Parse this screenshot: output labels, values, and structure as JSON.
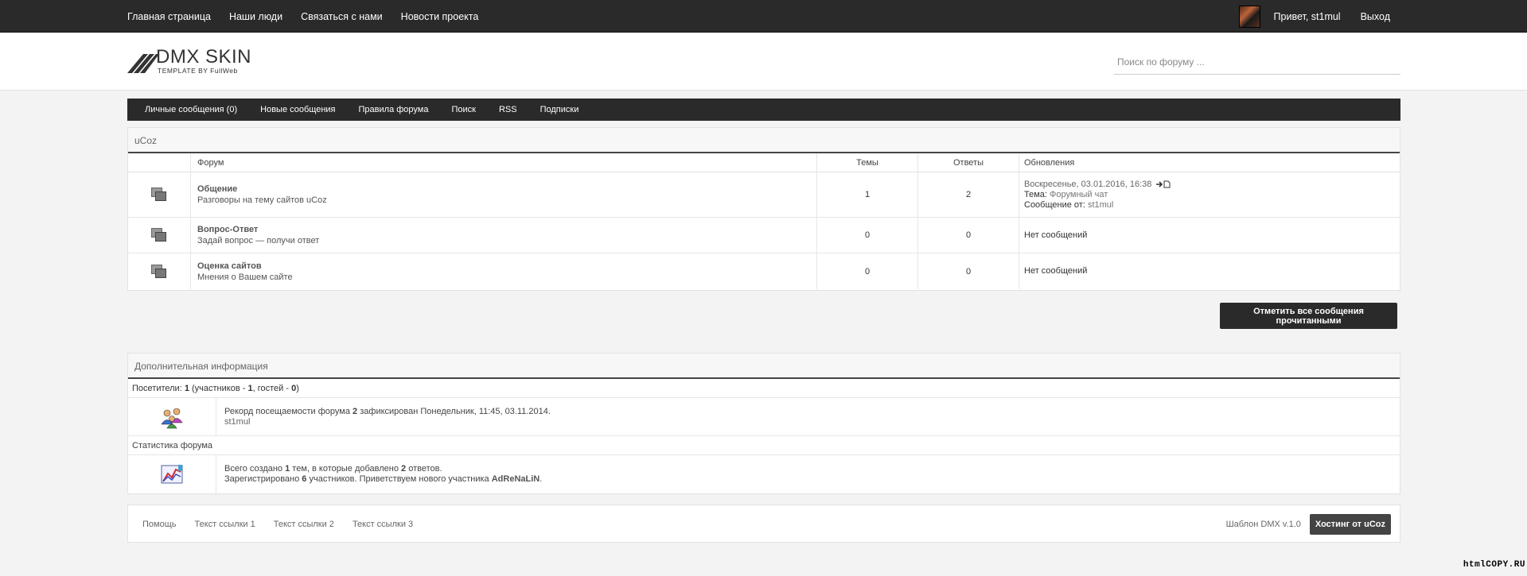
{
  "topbar": {
    "nav": [
      "Главная страница",
      "Наши люди",
      "Связаться с нами",
      "Новости проекта"
    ],
    "greeting": "Привет, st1mul",
    "logout": "Выход"
  },
  "header": {
    "logo_name": "DMX SKIN",
    "logo_sub": "TEMPLATE BY FullWeb",
    "search_placeholder": "Поиск по форуму ..."
  },
  "subnav": [
    "Личные сообщения (0)",
    "Новые сообщения",
    "Правила форума",
    "Поиск",
    "RSS",
    "Подписки"
  ],
  "forum": {
    "section_title": "uCoz",
    "columns": {
      "forum": "Форум",
      "topics": "Темы",
      "answers": "Ответы",
      "updates": "Обновления"
    },
    "rows": [
      {
        "name": "Общение",
        "desc": "Разговоры на тему сайтов uCoz",
        "topics": "1",
        "answers": "2",
        "upd_date": "Воскресенье, 03.01.2016, 16:38",
        "upd_topic_label": "Тема:",
        "upd_topic": "Форумный чат",
        "upd_author_label": "Сообщение от:",
        "upd_author": "st1mul"
      },
      {
        "name": "Вопрос-Ответ",
        "desc": "Задай вопрос — получи ответ",
        "topics": "0",
        "answers": "0",
        "no_msgs": "Нет сообщений"
      },
      {
        "name": "Оценка сайтов",
        "desc": "Мнения о Вашем сайте",
        "topics": "0",
        "answers": "0",
        "no_msgs": "Нет сообщений"
      }
    ],
    "mark_read": "Отметить все сообщения прочитанными"
  },
  "info": {
    "title": "Дополнительная информация",
    "visitors_label": "Посетители:",
    "visitors_total": "1",
    "members_label": "участников -",
    "members": "1",
    "guests_label": "гостей -",
    "guests": "0",
    "record_text_1": "Рекорд посещаемости форума",
    "record_value": "2",
    "record_text_2": "зафиксирован Понедельник, 11:45, 03.11.2014.",
    "record_user": "st1mul",
    "stats_label": "Статистика форума",
    "stats_text_1": "Всего создано",
    "stats_topics": "1",
    "stats_text_2": "тем, в которые добавлено",
    "stats_answers": "2",
    "stats_text_3": "ответов.",
    "reg_text_1": "Зарегистрировано",
    "reg_count": "6",
    "reg_text_2": "участников. Приветствуем нового участника",
    "reg_new_user": "AdReNaLiN"
  },
  "footer": {
    "links": [
      "Помощь",
      "Текст ссылки 1",
      "Текст ссылки 2",
      "Текст ссылки 3"
    ],
    "version": "Шаблон DMX v.1.0",
    "hosting": "Хостинг от uCoz"
  },
  "watermark": "htmlCOPY.RU"
}
